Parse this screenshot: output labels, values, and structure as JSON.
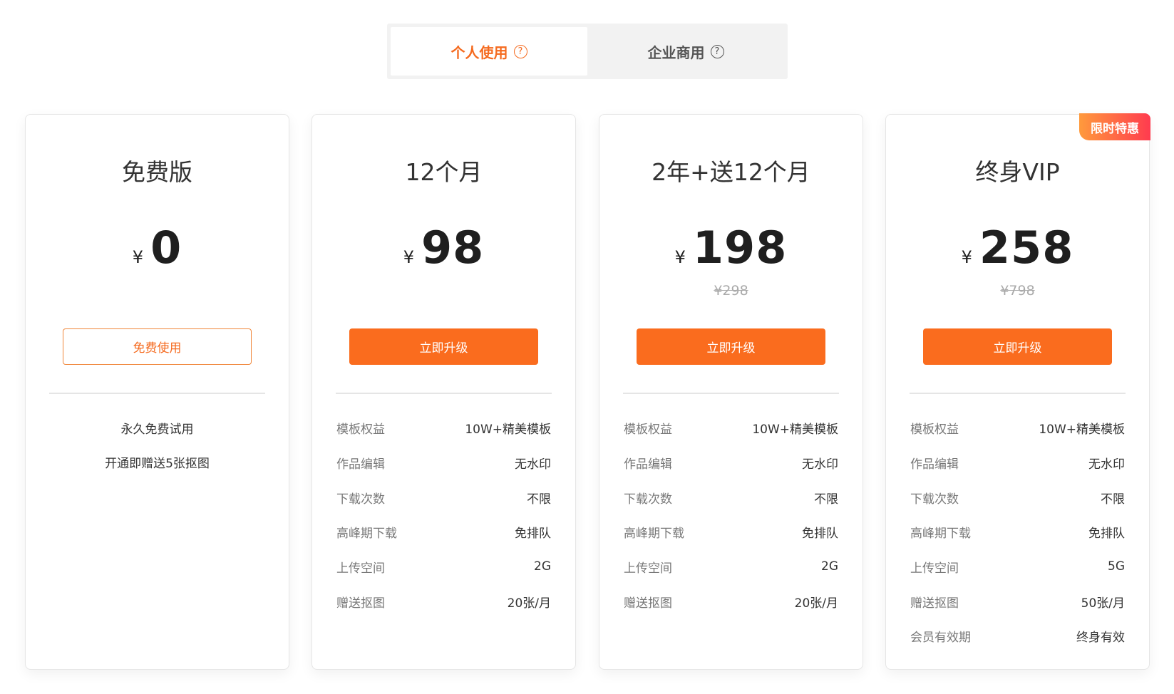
{
  "tabs": [
    {
      "label": "个人使用",
      "help": "?"
    },
    {
      "label": "企业商用",
      "help": "?"
    }
  ],
  "colors": {
    "accent": "#fa6c1e",
    "badge_from": "#ff9a3c",
    "badge_to": "#ff3b4f"
  },
  "plans": [
    {
      "title": "免费版",
      "currency": "¥",
      "price": "0",
      "button": "免费使用",
      "notes": [
        "永久免费试用",
        "开通即赠送5张抠图"
      ]
    },
    {
      "title": "12个月",
      "currency": "¥",
      "price": "98",
      "button": "立即升级",
      "features": [
        {
          "k": "模板权益",
          "v": "10W+精美模板"
        },
        {
          "k": "作品编辑",
          "v": "无水印"
        },
        {
          "k": "下载次数",
          "v": "不限"
        },
        {
          "k": "高峰期下载",
          "v": "免排队"
        },
        {
          "k": "上传空间",
          "v": "2G"
        },
        {
          "k": "赠送抠图",
          "v": "20张/月"
        }
      ]
    },
    {
      "title": "2年+送12个月",
      "currency": "¥",
      "price": "198",
      "original": "¥298",
      "button": "立即升级",
      "features": [
        {
          "k": "模板权益",
          "v": "10W+精美模板"
        },
        {
          "k": "作品编辑",
          "v": "无水印"
        },
        {
          "k": "下载次数",
          "v": "不限"
        },
        {
          "k": "高峰期下载",
          "v": "免排队"
        },
        {
          "k": "上传空间",
          "v": "2G"
        },
        {
          "k": "赠送抠图",
          "v": "20张/月"
        }
      ]
    },
    {
      "title": "终身VIP",
      "currency": "¥",
      "price": "258",
      "original": "¥798",
      "button": "立即升级",
      "badge": "限时特惠",
      "features": [
        {
          "k": "模板权益",
          "v": "10W+精美模板"
        },
        {
          "k": "作品编辑",
          "v": "无水印"
        },
        {
          "k": "下载次数",
          "v": "不限"
        },
        {
          "k": "高峰期下载",
          "v": "免排队"
        },
        {
          "k": "上传空间",
          "v": "5G"
        },
        {
          "k": "赠送抠图",
          "v": "50张/月"
        },
        {
          "k": "会员有效期",
          "v": "终身有效"
        }
      ]
    }
  ]
}
